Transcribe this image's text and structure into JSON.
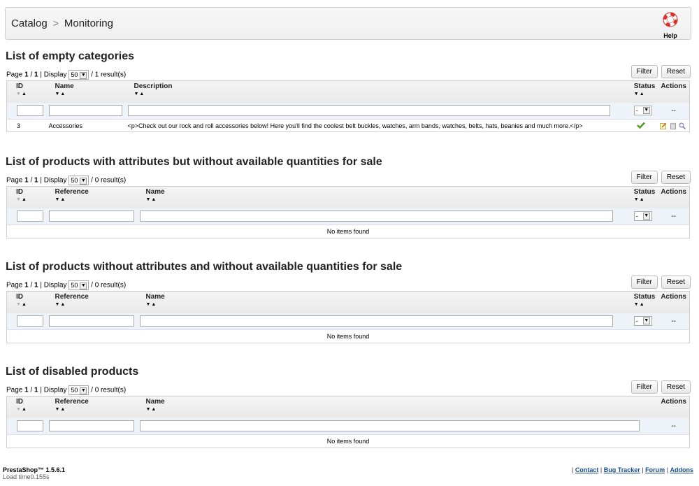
{
  "breadcrumb": {
    "parent": "Catalog",
    "separator": ">",
    "current": "Monitoring"
  },
  "help": {
    "label": "Help"
  },
  "buttons": {
    "filter": "Filter",
    "reset": "Reset"
  },
  "pager": {
    "page_word": "Page",
    "page": "1",
    "pages": "1",
    "display_word": "Display",
    "display_value": "50"
  },
  "sections": [
    {
      "title": "List of empty categories",
      "results": "/ 1 result(s)",
      "columns": {
        "id": "ID",
        "name": "Name",
        "description": "Description",
        "status": "Status",
        "actions": "Actions"
      },
      "filter_status": "-",
      "filter_actions": "--",
      "rows": [
        {
          "id": "3",
          "name": "Accessories",
          "description": "<p>Check out our rock and roll accessories below! Here you'll find the coolest belt buckles, watches, arm bands, watches, belts, hats, beanies and much more.</p>",
          "status": "enabled"
        }
      ]
    },
    {
      "title": "List of products with attributes but without available quantities for sale",
      "results": "/ 0 result(s)",
      "columns": {
        "id": "ID",
        "reference": "Reference",
        "name": "Name",
        "status": "Status",
        "actions": "Actions"
      },
      "filter_status": "-",
      "filter_actions": "--",
      "empty": "No items found"
    },
    {
      "title": "List of products without attributes and without available quantities for sale",
      "results": "/ 0 result(s)",
      "columns": {
        "id": "ID",
        "reference": "Reference",
        "name": "Name",
        "status": "Status",
        "actions": "Actions"
      },
      "filter_status": "-",
      "filter_actions": "--",
      "empty": "No items found"
    },
    {
      "title": "List of disabled products",
      "results": "/ 0 result(s)",
      "columns": {
        "id": "ID",
        "reference": "Reference",
        "name": "Name",
        "actions": "Actions"
      },
      "filter_actions": "--",
      "empty": "No items found"
    }
  ],
  "footer": {
    "version": "PrestaShop™ 1.5.6.1",
    "load_time": "Load time0.155s",
    "links": [
      "Contact",
      "Bug Tracker",
      "Forum",
      "Addons"
    ],
    "separator": "|"
  },
  "colors": {
    "status_ok": "#4a9a1e",
    "link": "#1a4d8c",
    "filter_row_bg": "#eef3f9"
  }
}
